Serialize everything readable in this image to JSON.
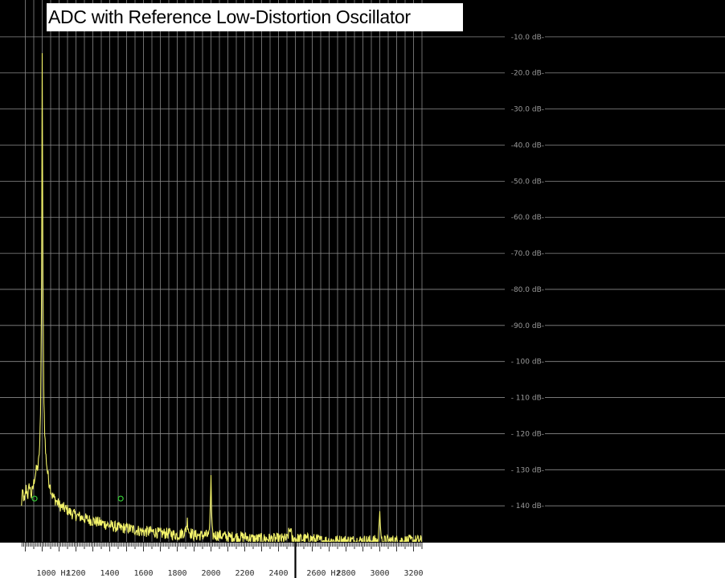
{
  "title": "ADC with Reference Low-Distortion Oscillator",
  "colors": {
    "background": "#000000",
    "grid": "#8a8a8a",
    "trace": "#f2f26a",
    "marker": "#33cc33",
    "axis_strip": "#ffffff"
  },
  "chart_data": {
    "type": "line",
    "title": "ADC with Reference Low-Distortion Oscillator",
    "xlabel": "",
    "ylabel": "",
    "x_unit": "Hz",
    "y_unit": "dB",
    "xlim": [
      875,
      3250
    ],
    "ylim": [
      -150,
      0
    ],
    "grid": true,
    "legend": "none",
    "y_ticks": [
      "-10.0 dB-",
      "-20.0 dB-",
      "-30.0 dB-",
      "-40.0 dB-",
      "-50.0 dB-",
      "-60.0 dB-",
      "-70.0 dB-",
      "-80.0 dB-",
      "-90.0 dB-",
      "- 100 dB-",
      "- 110 dB-",
      "- 120 dB-",
      "- 130 dB-",
      "- 140 dB-"
    ],
    "x_ticks": [
      "1000 Hz",
      "1200",
      "1400",
      "1600",
      "1800",
      "2000",
      "2200",
      "2400",
      "2600 Hz",
      "2800",
      "3000",
      "3200"
    ],
    "peaks": [
      {
        "freq": 1000,
        "level": -14.5
      },
      {
        "freq": 2000,
        "level": -131.5
      },
      {
        "freq": 3000,
        "level": -141.5
      }
    ],
    "markers": [
      {
        "freq": 955,
        "level": -138
      },
      {
        "freq": 1465,
        "level": -138
      }
    ],
    "cursor_freq": 2500,
    "series": [
      {
        "x": [
          875,
          885,
          895,
          905,
          915,
          925,
          935,
          945,
          955,
          965,
          975,
          980,
          985,
          990,
          993,
          996,
          998,
          1000,
          1002,
          1004,
          1007,
          1010,
          1015,
          1020,
          1030,
          1040,
          1050,
          1060,
          1075,
          1090,
          1110,
          1130,
          1150,
          1175,
          1200,
          1230,
          1260,
          1300,
          1340,
          1380,
          1420,
          1460,
          1500,
          1550,
          1600,
          1650,
          1700,
          1750,
          1800,
          1850,
          1860,
          1870,
          1900,
          1950,
          1990,
          1996,
          2000,
          2004,
          2010,
          2050,
          2100,
          2150,
          2200,
          2250,
          2300,
          2350,
          2400,
          2450,
          2470,
          2480,
          2500,
          2540,
          2600,
          2650,
          2700,
          2750,
          2800,
          2850,
          2900,
          2950,
          2990,
          2996,
          3000,
          3004,
          3010,
          3050,
          3100,
          3150,
          3200,
          3250
        ],
        "y": [
          -140,
          -136,
          -139,
          -135,
          -137,
          -134,
          -137,
          -135,
          -132,
          -130,
          -129,
          -127,
          -123,
          -115,
          -100,
          -80,
          -50,
          -14.5,
          -40,
          -70,
          -95,
          -110,
          -119,
          -125,
          -130,
          -133,
          -135,
          -137,
          -138,
          -139,
          -140,
          -140.5,
          -141,
          -142,
          -142.5,
          -143,
          -143.5,
          -144,
          -144.5,
          -145,
          -145.5,
          -146,
          -146,
          -146.5,
          -147,
          -147,
          -147.5,
          -147.5,
          -148,
          -147,
          -144,
          -147,
          -148,
          -148,
          -148,
          -140,
          -131.5,
          -142,
          -148,
          -148,
          -148.5,
          -148.5,
          -148.5,
          -149,
          -149,
          -149,
          -149,
          -149,
          -146,
          -149,
          -149,
          -149,
          -149,
          -149.5,
          -149.5,
          -149.5,
          -149.5,
          -149.5,
          -149.5,
          -149.5,
          -149.5,
          -145,
          -141.5,
          -146,
          -149.5,
          -149.5,
          -149.5,
          -149.5,
          -149.5,
          -149.5
        ]
      }
    ]
  }
}
